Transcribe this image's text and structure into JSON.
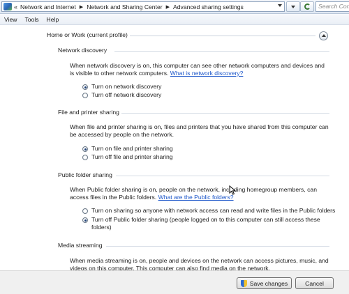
{
  "breadcrumb": {
    "overflow": "«",
    "items": [
      "Network and Internet",
      "Network and Sharing Center",
      "Advanced sharing settings"
    ],
    "separator": "▶"
  },
  "search": {
    "placeholder": "Search Con"
  },
  "menu": [
    "View",
    "Tools",
    "Help"
  ],
  "profile": {
    "title": "Home or Work (current profile)"
  },
  "sections": {
    "network_discovery": {
      "title": "Network discovery",
      "desc": "When network discovery is on, this computer can see other network computers and devices and is visible to other network computers.",
      "link": "What is network discovery?",
      "options": [
        "Turn on network discovery",
        "Turn off network discovery"
      ]
    },
    "file_printer": {
      "title": "File and printer sharing",
      "desc": "When file and printer sharing is on, files and printers that you have shared from this computer can be accessed by people on the network.",
      "options": [
        "Turn on file and printer sharing",
        "Turn off file and printer sharing"
      ]
    },
    "public_folder": {
      "title": "Public folder sharing",
      "desc": "When Public folder sharing is on, people on the network, including homegroup members, can access files in the Public folders.",
      "link": "What are the Public folders?",
      "options": [
        "Turn on sharing so anyone with network access can read and write files in the Public folders",
        "Turn off Public folder sharing (people logged on to this computer can still access these folders)"
      ]
    },
    "media_streaming": {
      "title": "Media streaming",
      "desc": "When media streaming is on, people and devices on the network can access pictures, music, and videos on this computer. This computer can also find media on the network."
    }
  },
  "buttons": {
    "save": "Save changes",
    "cancel": "Cancel"
  },
  "icons": {
    "network": "network-icon",
    "refresh": "refresh-icon",
    "collapse": "chevron-up-icon",
    "shield": "uac-shield-icon",
    "cursor": "mouse-cursor-icon"
  }
}
